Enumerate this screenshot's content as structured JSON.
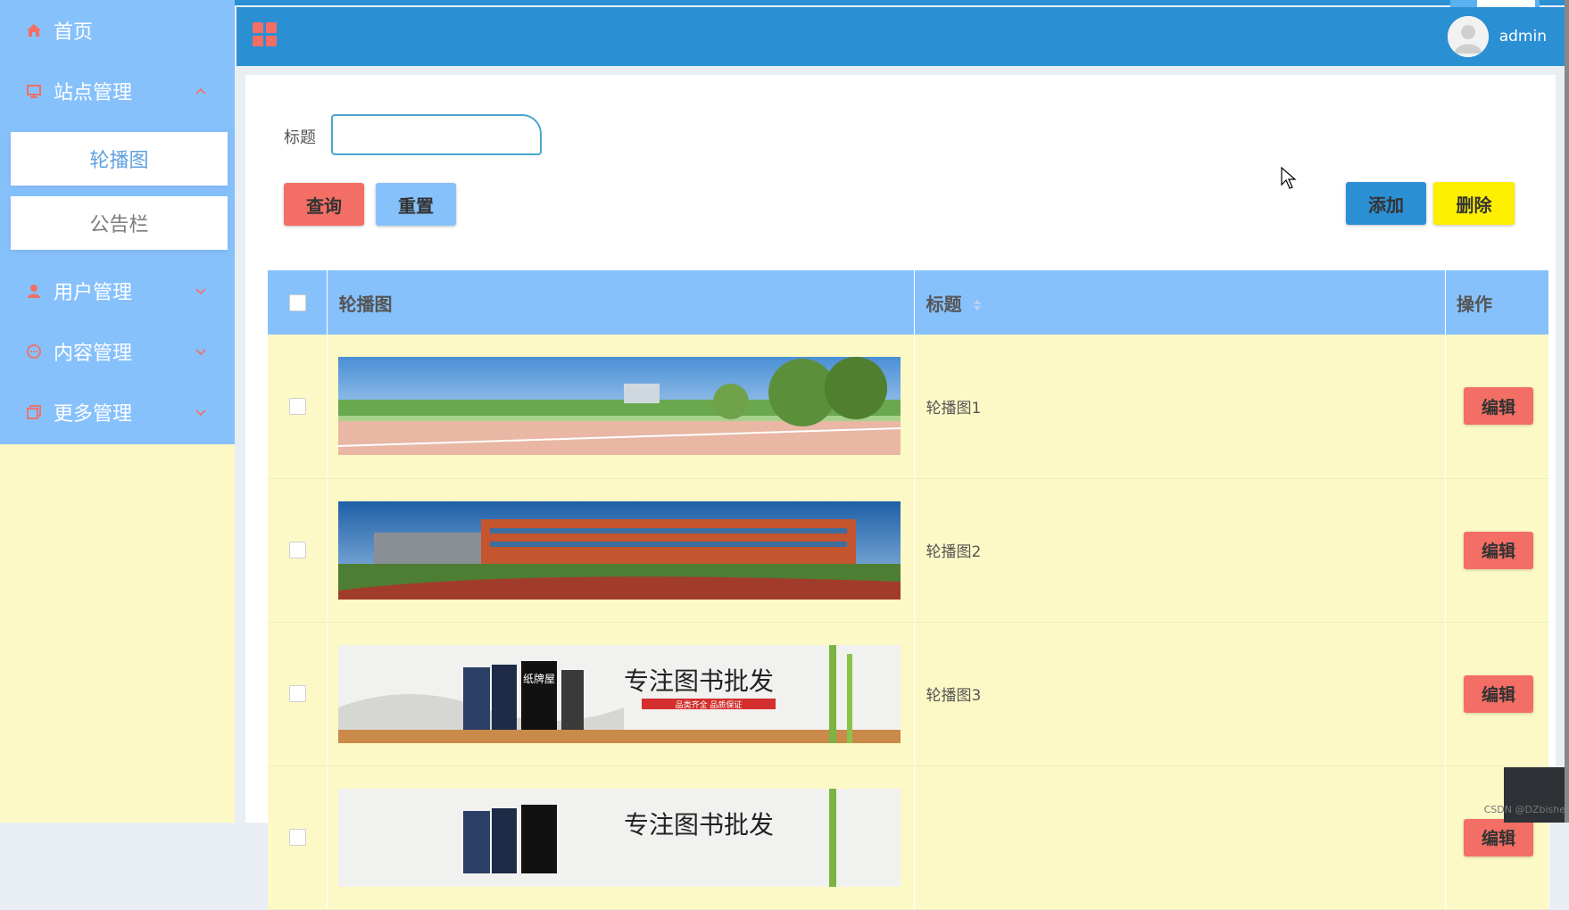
{
  "header": {
    "username": "admin"
  },
  "sidebar": {
    "home": "首页",
    "site_mgmt": "站点管理",
    "sub_items": [
      "轮播图",
      "公告栏"
    ],
    "user_mgmt": "用户管理",
    "content_mgmt": "内容管理",
    "more_mgmt": "更多管理"
  },
  "search": {
    "label": "标题",
    "value": "",
    "query": "查询",
    "reset": "重置",
    "add": "添加",
    "delete": "删除"
  },
  "table": {
    "headers": {
      "image": "轮播图",
      "title": "标题",
      "actions": "操作"
    },
    "rows": [
      {
        "title": "轮播图1",
        "edit": "编辑"
      },
      {
        "title": "轮播图2",
        "edit": "编辑"
      },
      {
        "title": "轮播图3",
        "edit": "编辑"
      },
      {
        "title": "",
        "edit": "编辑"
      }
    ]
  },
  "banner3": {
    "main_text": "专注图书批发",
    "sub_text": "品类齐全 品质保证",
    "brand": "纸牌屋"
  },
  "watermark": "CSDN @DZbishe",
  "colors": {
    "primary": "#2b8fd4",
    "menu": "#87c1fb",
    "row_bg": "#fdf9c6",
    "danger": "#f36e64",
    "warning": "#ffef00"
  }
}
